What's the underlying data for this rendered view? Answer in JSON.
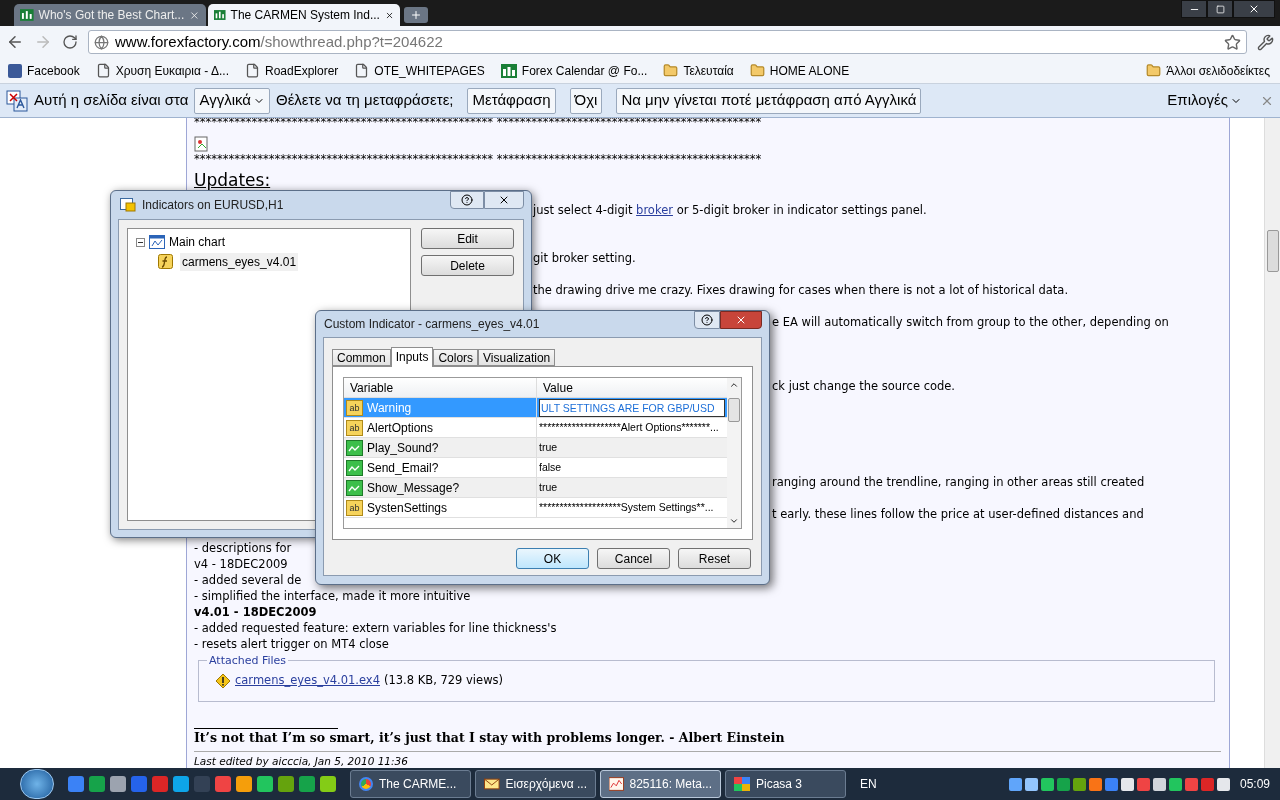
{
  "browser": {
    "tabs": [
      {
        "title": "Who's Got the Best Chart...",
        "selected": false
      },
      {
        "title": "The CARMEN System Ind...",
        "selected": true
      }
    ],
    "address": {
      "host": "www.forexfactory.com",
      "path": "/showthread.php?t=204622"
    },
    "bookmarks": [
      {
        "label": "Facebook",
        "kind": "facebook"
      },
      {
        "label": "Χρυση Ευκαιρια - Δ...",
        "kind": "page"
      },
      {
        "label": "RoadExplorer",
        "kind": "page"
      },
      {
        "label": "OTE_WHITEPAGES",
        "kind": "page"
      },
      {
        "label": "Forex Calendar @ Fo...",
        "kind": "calendar"
      },
      {
        "label": "Τελευταία",
        "kind": "folder"
      },
      {
        "label": "HOME ALONE",
        "kind": "folder"
      }
    ],
    "other_bookmarks": "Άλλοι σελιδοδείκτες"
  },
  "translate_bar": {
    "prefix": "Αυτή η σελίδα είναι στα",
    "language": "Αγγλικά",
    "question": "Θέλετε να τη μεταφράσετε;",
    "buttons": [
      "Μετάφραση",
      "Όχι",
      "Να μην γίνεται ποτέ μετάφραση από Αγγλικά"
    ],
    "options": "Επιλογές"
  },
  "page": {
    "stars_top": "**************************************************** **********************************************",
    "stars_bottom": "**************************************************** **********************************************",
    "heading": "Updates:",
    "fragments_a": [
      {
        "text": "just select 4-digit",
        "link": "broker",
        "after": "or 5-digit broker in indicator settings panel."
      },
      {
        "text": "git broker setting."
      },
      {
        "text": "the drawing drive me crazy. Fixes drawing for cases when there is not a lot of historical data."
      }
    ],
    "fragments_b": [
      {
        "text": "e EA will automatically switch from group to the other, depending on"
      },
      {
        "text": "ck just change the source code."
      },
      {
        "text": "ranging around the trendline, ranging in other areas still created"
      },
      {
        "text": "t early. these lines follow the price at user-defined distances and"
      }
    ],
    "lines": [
      {
        "text": "- descriptions for",
        "kind": "text"
      },
      {
        "text": "v4 - 18DEC2009",
        "kind": "text"
      },
      {
        "text": "- added several de",
        "kind": "text"
      },
      {
        "text": "- simplified the interface, made it more intuitive",
        "kind": "text"
      },
      {
        "text": "v4.01 - 18DEC2009",
        "kind": "version"
      },
      {
        "text": "- added requested feature: extern variables for line thickness's",
        "kind": "text"
      },
      {
        "text": "- resets alert trigger on MT4 close",
        "kind": "text"
      }
    ],
    "attachments": {
      "legend": "Attached Files",
      "file": "carmens_eyes_v4.01.ex4",
      "info": "(13.8 KB, 729 views)"
    },
    "quote": "It’s not that I’m so smart, it’s just that I stay with problems longer. - Albert Einstein",
    "last_edited": "Last edited by aicccia, Jan 5, 2010 11:36"
  },
  "indicators_dialog": {
    "title": "Indicators on EURUSD,H1",
    "tree": [
      {
        "label": "Main chart",
        "expanded": true,
        "children": [
          {
            "label": "carmens_eyes_v4.01"
          }
        ]
      }
    ],
    "buttons": [
      "Edit",
      "Delete"
    ]
  },
  "custom_dialog": {
    "title": "Custom Indicator - carmens_eyes_v4.01",
    "tabs": [
      {
        "label": "Common",
        "selected": false
      },
      {
        "label": "Inputs",
        "selected": true
      },
      {
        "label": "Colors",
        "selected": false
      },
      {
        "label": "Visualization",
        "selected": false
      }
    ],
    "columns": [
      "Variable",
      "Value"
    ],
    "rows": [
      {
        "variable": "Warning",
        "value": "ULT SETTINGS ARE FOR GBP/USD",
        "kind": "string",
        "icon_text": "ab",
        "selected": true
      },
      {
        "variable": "AlertOptions",
        "value": "********************Alert Options*******...",
        "kind": "string",
        "icon_text": "ab",
        "selected": false
      },
      {
        "variable": "Play_Sound?",
        "value": "true",
        "kind": "bool",
        "selected": false
      },
      {
        "variable": "Send_Email?",
        "value": "false",
        "kind": "bool",
        "selected": false
      },
      {
        "variable": "Show_Message?",
        "value": "true",
        "kind": "bool",
        "selected": false
      },
      {
        "variable": "SystenSettings",
        "value": "********************System Settings**...",
        "kind": "string",
        "icon_text": "ab",
        "selected": false
      }
    ],
    "buttons": [
      {
        "label": "OK",
        "default": true
      },
      {
        "label": "Cancel",
        "default": false
      },
      {
        "label": "Reset",
        "default": false
      }
    ]
  },
  "taskbar": {
    "tasks": [
      {
        "label": "The CARME...",
        "kind": "browser",
        "selected": false
      },
      {
        "label": "Εισερχόμενα ...",
        "kind": "mail",
        "selected": false
      },
      {
        "label": "825116: Meta...",
        "kind": "chart",
        "selected": true
      },
      {
        "label": "Picasa 3",
        "kind": "photos",
        "selected": false
      }
    ],
    "language": "EN",
    "clock": "05:09"
  }
}
